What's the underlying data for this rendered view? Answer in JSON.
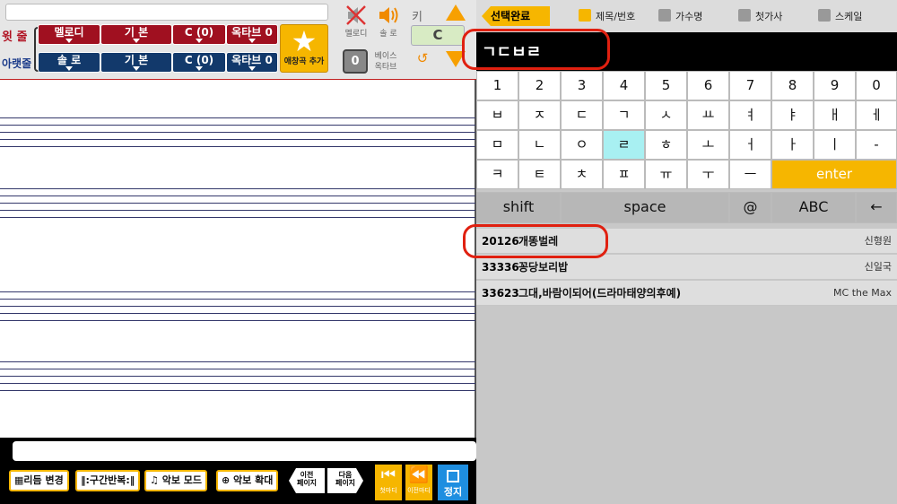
{
  "left_toolbar": {
    "upper_row_label": "윗 줄",
    "lower_row_label": "아랫줄",
    "upper": {
      "instrument": "멜로디",
      "style": "기 본",
      "key": "C (0)",
      "octave": "옥타브 0"
    },
    "lower": {
      "instrument": "솔 로",
      "style": "기 본",
      "key": "C (0)",
      "octave": "옥타브 0"
    },
    "add_favorite_label": "애창곡 추가",
    "melody_label": "멜로디",
    "solo_label": "솔 로",
    "key_label": "키",
    "key_value": "C",
    "bass_octave_value": "0",
    "bass_octave_label_1": "베이스",
    "bass_octave_label_2": "옥타브"
  },
  "bottom_toolbar": {
    "rhythm_change": "리듬 변경",
    "section_repeat": "구간반복",
    "score_mode": "악보 모드",
    "score_zoom": "악보 확대",
    "prev_page_1": "이전",
    "prev_page_2": "페이지",
    "next_page_1": "다음",
    "next_page_2": "페이지",
    "first_bar": "첫마디",
    "prev_bar": "이전마디",
    "stop": "정지"
  },
  "right_panel": {
    "done_button": "선택완료",
    "filters": [
      {
        "label": "제목/번호",
        "checked": true
      },
      {
        "label": "가수명",
        "checked": false
      },
      {
        "label": "첫가사",
        "checked": false
      },
      {
        "label": "스케일",
        "checked": false
      }
    ],
    "search_text": "ㄱㄷㅂㄹ",
    "keyboard": {
      "row1": [
        "1",
        "2",
        "3",
        "4",
        "5",
        "6",
        "7",
        "8",
        "9",
        "0"
      ],
      "row2": [
        "ㅂ",
        "ㅈ",
        "ㄷ",
        "ㄱ",
        "ㅅ",
        "ㅛ",
        "ㅕ",
        "ㅑ",
        "ㅐ",
        "ㅔ"
      ],
      "row3": [
        "ㅁ",
        "ㄴ",
        "ㅇ",
        "ㄹ",
        "ㅎ",
        "ㅗ",
        "ㅓ",
        "ㅏ",
        "ㅣ",
        "-"
      ],
      "row4": [
        "ㅋ",
        "ㅌ",
        "ㅊ",
        "ㅍ",
        "ㅠ",
        "ㅜ",
        "ㅡ"
      ],
      "enter": "enter",
      "shift": "shift",
      "space": "space",
      "at": "@",
      "abc": "ABC",
      "backspace": "←"
    },
    "results": [
      {
        "number": "20126",
        "title": "개똥벌레",
        "singer": "신형원"
      },
      {
        "number": "33336",
        "title": "꽁당보리밥",
        "singer": "신일국"
      },
      {
        "number": "33623",
        "title": "그대,바람이되어(드라마태양의후예)",
        "singer": "MC the Max"
      }
    ]
  },
  "colors": {
    "accent": "#f6b600",
    "melody_red": "#a01020",
    "solo_blue": "#12396b",
    "annotation": "#e02010"
  }
}
